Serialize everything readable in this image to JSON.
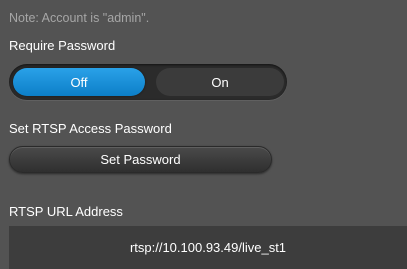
{
  "note": "Note: Account is \"admin\".",
  "require_password": {
    "label": "Require Password",
    "options": [
      "Off",
      "On"
    ],
    "selected": "Off"
  },
  "rtsp_access_password": {
    "label": "Set RTSP Access Password",
    "button_label": "Set Password"
  },
  "rtsp_url": {
    "label": "RTSP URL Address",
    "value": "rtsp://10.100.93.49/live_st1"
  },
  "colors": {
    "background": "#535353",
    "accent": "#1a8fd6",
    "note_text": "#a6a6a6"
  }
}
